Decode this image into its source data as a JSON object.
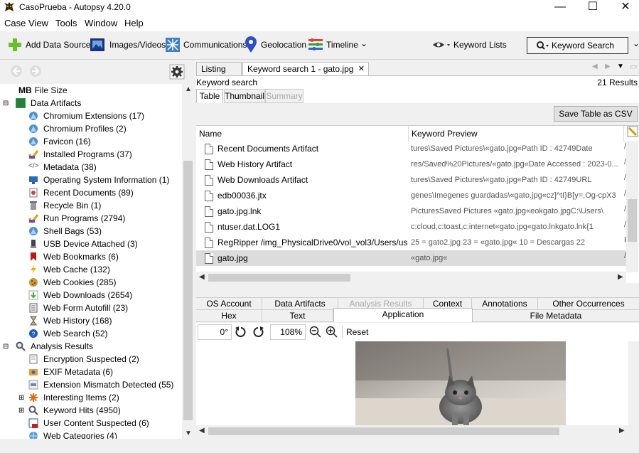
{
  "window": {
    "title": "CasoPrueba - Autopsy 4.20.0",
    "minimize": "—",
    "maximize": "☐",
    "close": "✕"
  },
  "menu": [
    "Case",
    "View",
    "Tools",
    "Window",
    "Help"
  ],
  "toolbar": {
    "add_data_source": "Add Data Source",
    "images_videos": "Images/Videos",
    "communications": "Communications",
    "geolocation": "Geolocation",
    "timeline": "Timeline",
    "keyword_lists": "Keyword Lists",
    "keyword_search": "Keyword Search"
  },
  "tree": {
    "file_size": "File Size",
    "file_size_prefix": "MB",
    "data_artifacts": "Data Artifacts",
    "items": [
      "Chromium Extensions (17)",
      "Chromium Profiles (2)",
      "Favicon (16)",
      "Installed Programs (37)",
      "Metadata (38)",
      "Operating System Information (1)",
      "Recent Documents (89)",
      "Recycle Bin (1)",
      "Run Programs (2794)",
      "Shell Bags (53)",
      "USB Device Attached (3)",
      "Web Bookmarks (6)",
      "Web Cache (132)",
      "Web Cookies (285)",
      "Web Downloads (2654)",
      "Web Form Autofill (23)",
      "Web History (168)",
      "Web Search (52)"
    ],
    "analysis_results": "Analysis Results",
    "analysis_items": [
      "Encryption Suspected (2)",
      "EXIF Metadata (6)",
      "Extension Mismatch Detected (55)",
      "Interesting Items (2)",
      "Keyword Hits (4950)",
      "User Content Suspected (6)",
      "Web Categories (4)"
    ]
  },
  "tabs": {
    "listing": "Listing",
    "keyword_tab": "Keyword search 1 - gato.jpg",
    "close": "✕"
  },
  "results": {
    "header": "Keyword search",
    "count": "21  Results",
    "table_tab": "Table",
    "thumbnail_tab": "Thumbnail",
    "summary_tab": "Summary",
    "save_csv": "Save Table as CSV"
  },
  "columns": {
    "name": "Name",
    "preview": "Keyword Preview",
    "s": "S"
  },
  "rows": [
    {
      "name": "Recent Documents Artifact",
      "preview": "tures\\Saved Pictures\\«gato.jpg«Path ID : 42749Date",
      "s": "/"
    },
    {
      "name": "Web History Artifact",
      "preview": "res/Saved%20Pictures/«gato.jpg«Date Accessed : 2023-0...",
      "s": "/"
    },
    {
      "name": "Web Downloads Artifact",
      "preview": "tures\\Saved Pictures\\«gato.jpg«Path ID : 42749URL",
      "s": "/"
    },
    {
      "name": "edb00036.jtx",
      "preview": "genes\\Imegenes guardadas\\«gato.jpg«cz]^tI}B[y=,Og-cpX3",
      "s": "/"
    },
    {
      "name": "gato.jpg.lnk",
      "preview": "PicturesSaved Pictures «gato.jpg«eokgato.jpgC:\\Users\\",
      "s": "/"
    },
    {
      "name": "ntuser.dat.LOG1",
      "preview": "c:cloud,c:toast,c:internet«gato.jpg«gato.lnkgato.lnk{1",
      "s": "/"
    },
    {
      "name": "RegRipper /img_PhysicalDrive0/vol_vol3/Users/usuario/N",
      "preview": "25 = gato2.jpg  23 = «gato.jpg«  10 = Descargas  22",
      "s": "F"
    },
    {
      "name": "gato.jpg",
      "preview": "«gato.jpg«",
      "s": "/"
    }
  ],
  "content_tabs_row1": [
    "OS Account",
    "Data Artifacts",
    "Analysis Results",
    "Context",
    "Annotations",
    "Other Occurrences"
  ],
  "content_tabs_row2": [
    "Hex",
    "Text",
    "Application",
    "File Metadata"
  ],
  "viewer": {
    "rotation": "0°",
    "zoom": "108%",
    "reset": "Reset"
  }
}
